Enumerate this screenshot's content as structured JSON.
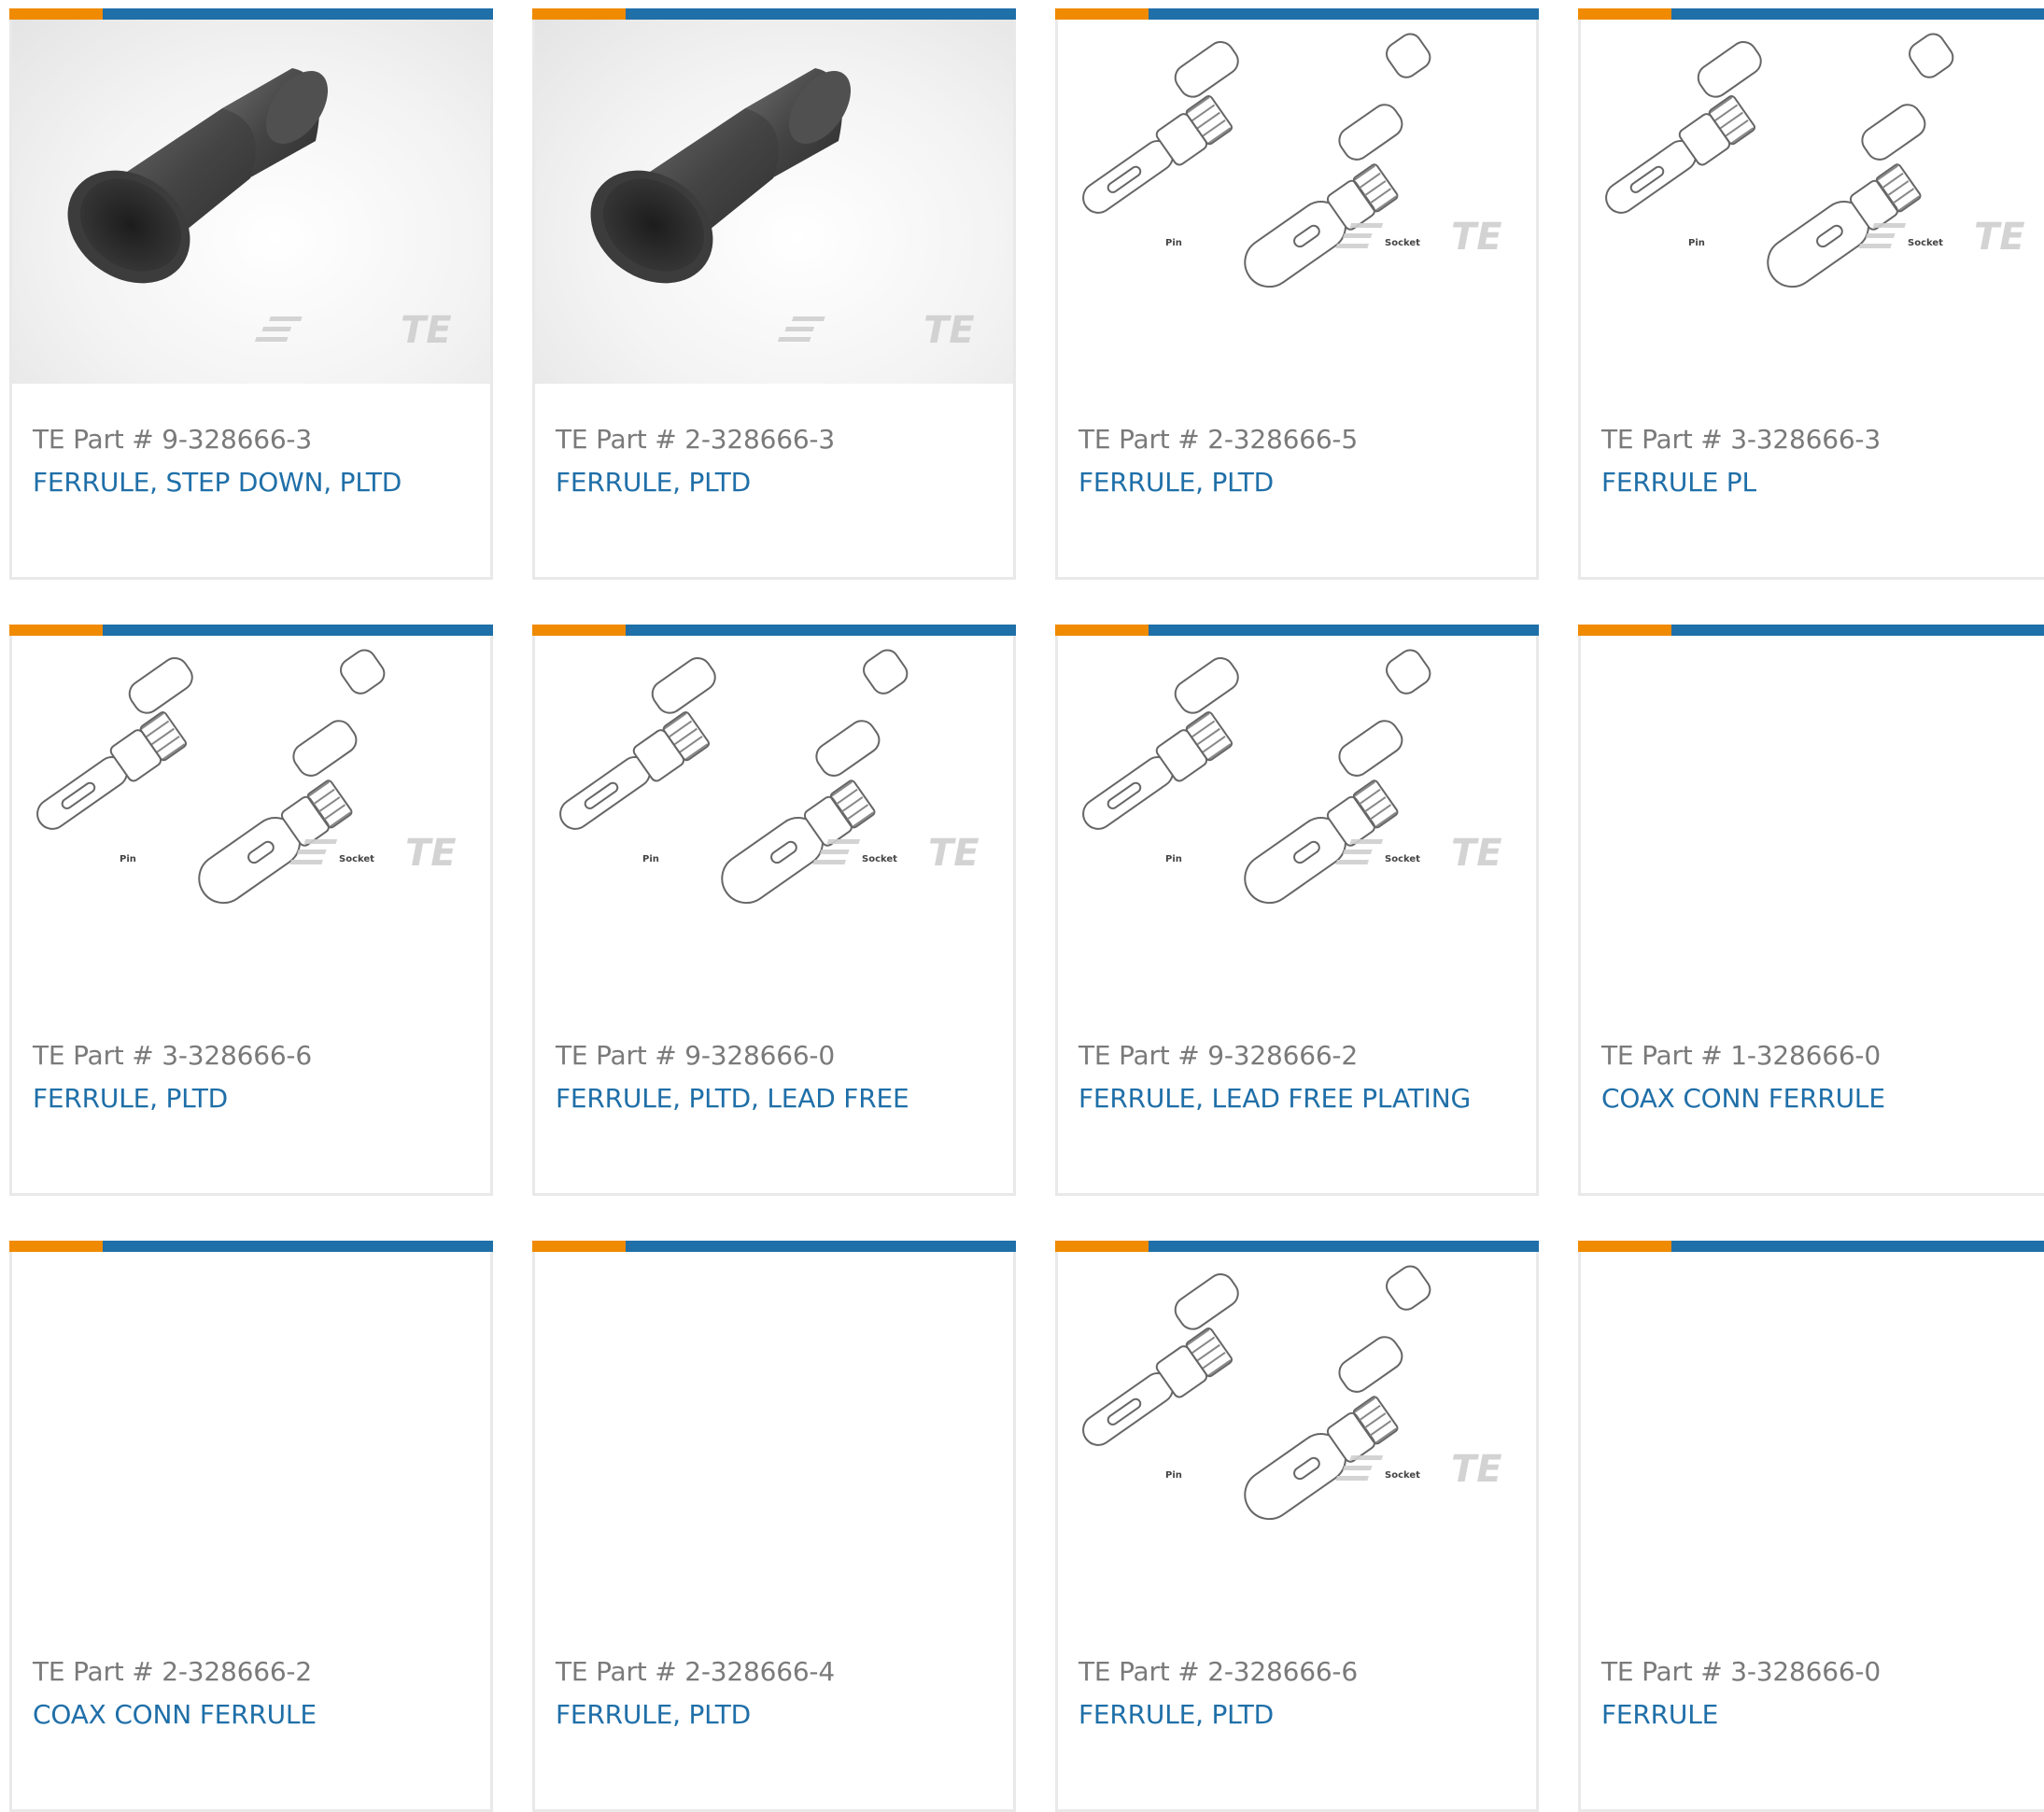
{
  "brand": {
    "accent_orange": "#f08a00",
    "accent_blue": "#1f6fa8",
    "watermark": "TE"
  },
  "products": [
    {
      "part_label": "TE Part # 9-328666-3",
      "description": "FERRULE, STEP DOWN, PLTD",
      "image": "ferrule-step-down-photo"
    },
    {
      "part_label": "TE Part # 2-328666-3",
      "description": "FERRULE, PLTD",
      "image": "ferrule-step-down-photo"
    },
    {
      "part_label": "TE Part # 2-328666-5",
      "description": "FERRULE, PLTD",
      "image": "pin-socket-drawing"
    },
    {
      "part_label": "TE Part # 3-328666-3",
      "description": "FERRULE PL",
      "image": "pin-socket-drawing"
    },
    {
      "part_label": "TE Part # 3-328666-6",
      "description": "FERRULE, PLTD",
      "image": "pin-socket-drawing"
    },
    {
      "part_label": "TE Part # 9-328666-0",
      "description": "FERRULE, PLTD, LEAD FREE",
      "image": "pin-socket-drawing"
    },
    {
      "part_label": "TE Part # 9-328666-2",
      "description": "FERRULE, LEAD FREE PLATING",
      "image": "pin-socket-drawing"
    },
    {
      "part_label": "TE Part # 1-328666-0",
      "description": "COAX CONN FERRULE",
      "image": "none"
    },
    {
      "part_label": "TE Part # 2-328666-2",
      "description": "COAX CONN FERRULE",
      "image": "none"
    },
    {
      "part_label": "TE Part # 2-328666-4",
      "description": "FERRULE, PLTD",
      "image": "none"
    },
    {
      "part_label": "TE Part # 2-328666-6",
      "description": "FERRULE, PLTD",
      "image": "pin-socket-drawing"
    },
    {
      "part_label": "TE Part # 3-328666-0",
      "description": "FERRULE",
      "image": "none"
    }
  ],
  "drawing_labels": {
    "pin": "Pin",
    "socket": "Socket"
  }
}
